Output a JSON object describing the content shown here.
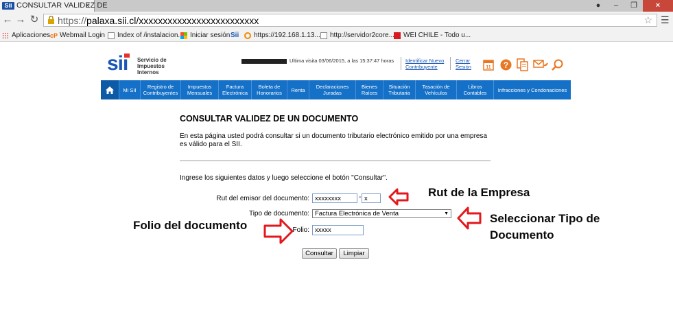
{
  "browser": {
    "tab_title": "CONSULTAR VALIDEZ DE",
    "tab_favicon_text": "Sii",
    "url_scheme": "https://",
    "url_host": "palaxa.sii.cl/xxxxxxxxxxxxxxxxxxxxxxxxx",
    "bookmarks": [
      {
        "label": "Aplicaciones",
        "icon": "apps-grid-icon"
      },
      {
        "label": "Webmail Login",
        "icon": "cpanel-icon",
        "prefix": "cP"
      },
      {
        "label": "Index of /instalacion...",
        "icon": "page-icon"
      },
      {
        "label": "Iniciar sesión",
        "icon": "windows-icon"
      },
      {
        "label": "",
        "icon": "sii-icon"
      },
      {
        "label": "https://192.168.1.13...",
        "icon": "refresh-ring-icon"
      },
      {
        "label": "http://servidor2core...",
        "icon": "page-icon"
      },
      {
        "label": "WEI CHILE - Todo u...",
        "icon": "wei-icon"
      }
    ]
  },
  "header": {
    "logo_mark": "sii",
    "logo_lines": [
      "Servicio de",
      "Impuestos",
      "Internos"
    ],
    "user_info": "Ultima visita 03/06/2015, a las 15:37:47 horas",
    "identify_link": [
      "Identificar Nuevo",
      "Contribuyente"
    ],
    "logout_link": [
      "Cerrar",
      "Sesión"
    ],
    "calendar_day": "11"
  },
  "nav": {
    "items": [
      "Mi SII",
      "Registro de Contribuyentes",
      "Impuestos Mensuales",
      "Factura Electrónica",
      "Boleta de Honorarios",
      "Renta",
      "Declaraciones Juradas",
      "Bienes Raíces",
      "Situación Tributaria",
      "Tasación de Vehículos",
      "Libros Contables",
      "Infracciones y Condonaciones"
    ]
  },
  "content": {
    "title": "CONSULTAR VALIDEZ DE UN DOCUMENTO",
    "intro": "En esta página usted podrá consultar si un documento tributario electrónico emitido por una empresa es válido para el SII.",
    "instructions": "Ingrese los siguientes datos y luego seleccione el botón \"Consultar\".",
    "form": {
      "rut_label": "Rut del emisor del documento:",
      "rut_value": "xxxxxxxx",
      "dash": "-",
      "dv_value": "x",
      "tipo_label": "Tipo de documento:",
      "tipo_value": "Factura Electrónica de Venta",
      "folio_label": "Folio:",
      "folio_value": "xxxxx"
    },
    "buttons": {
      "consultar": "Consultar",
      "limpiar": "Limpiar"
    }
  },
  "annotations": {
    "rut": "Rut de la Empresa",
    "tipo": [
      "Seleccionar Tipo de",
      "Documento"
    ],
    "folio": "Folio del documento",
    "arrow_color": "#e3171c"
  }
}
